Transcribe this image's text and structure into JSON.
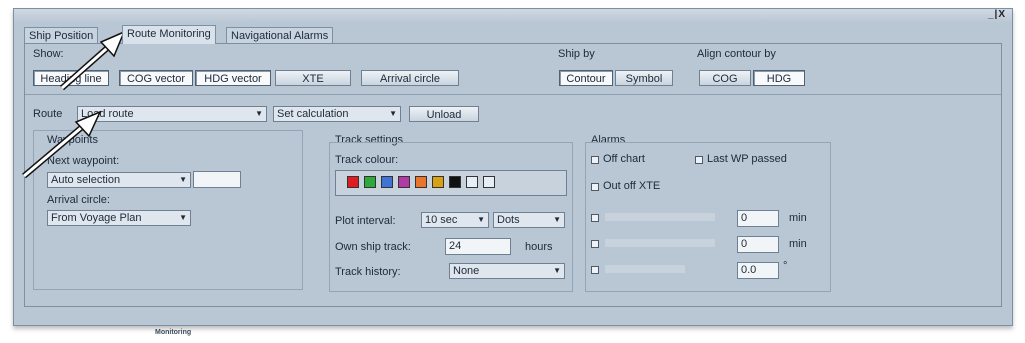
{
  "window": {
    "controls": "_|X"
  },
  "tabs": [
    {
      "label": "Ship Position"
    },
    {
      "label": "Route Monitoring"
    },
    {
      "label": "Navigational Alarms"
    }
  ],
  "show": {
    "label": "Show:",
    "buttons": [
      {
        "label": "Heading line",
        "active": true
      },
      {
        "label": "COG vector",
        "active": true
      },
      {
        "label": "HDG vector",
        "active": true
      },
      {
        "label": "XTE",
        "active": false
      },
      {
        "label": "Arrival circle",
        "active": false
      }
    ]
  },
  "ship_by": {
    "label": "Ship by",
    "buttons": [
      {
        "label": "Contour",
        "active": true
      },
      {
        "label": "Symbol",
        "active": false
      }
    ]
  },
  "align": {
    "label": "Align contour by",
    "buttons": [
      {
        "label": "COG",
        "active": false
      },
      {
        "label": "HDG",
        "active": true
      }
    ]
  },
  "route": {
    "label": "Route",
    "select": "Load route",
    "calc_select": "Set calculation",
    "unload": "Unload"
  },
  "waypoints": {
    "label": "Waypoints",
    "next_label": "Next waypoint:",
    "next_value": "Auto selection",
    "next_input": "",
    "arrival_label": "Arrival circle:",
    "arrival_value": "From Voyage Plan"
  },
  "track": {
    "label": "Track settings",
    "colour_label": "Track colour:",
    "colors": [
      "#e01b22",
      "#2eaa3c",
      "#3f74d6",
      "#b23aa6",
      "#e9742a",
      "#d8a114",
      "#111111",
      "#e6eef7",
      "#e6eef7"
    ],
    "plot_label": "Plot interval:",
    "plot_value": "10 sec",
    "plot_style": "Dots",
    "own_label": "Own ship track:",
    "own_value": "24",
    "own_unit": "hours",
    "history_label": "Track history:",
    "history_value": "None"
  },
  "alarms": {
    "label": "Alarms",
    "off_chart": "Off chart",
    "last_wp": "Last WP passed",
    "out_xte": "Out off XTE",
    "rows": [
      {
        "value": "0",
        "unit": "min"
      },
      {
        "value": "0",
        "unit": "min"
      },
      {
        "value": "0.0",
        "unit": "°"
      }
    ]
  },
  "footer": {
    "label": "Monitoring"
  }
}
